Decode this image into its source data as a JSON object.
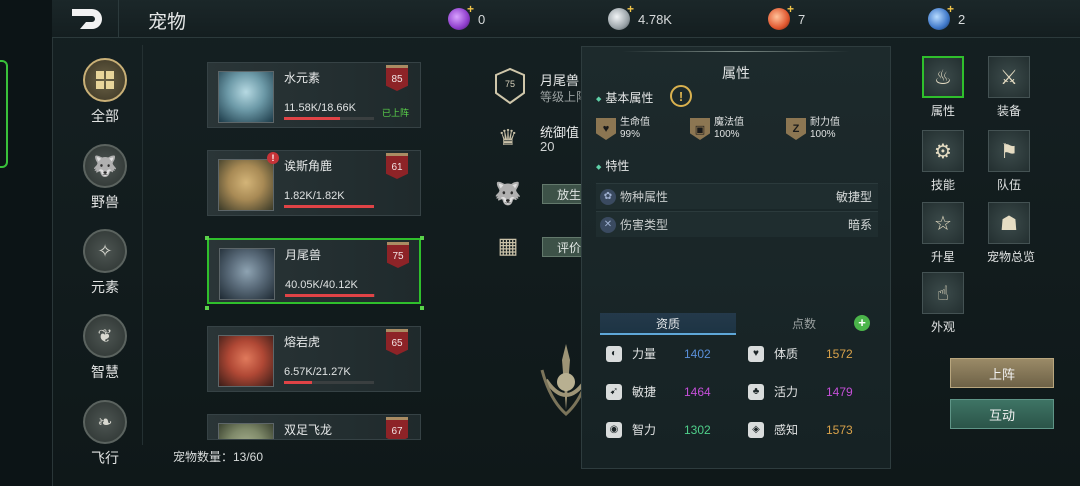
{
  "header": {
    "title": "宠物",
    "back_icon": "back-arrow-icon"
  },
  "resources": [
    {
      "name": "purple-gem",
      "value": "0",
      "color": "#8e3dcc"
    },
    {
      "name": "silver-coin",
      "value": "4.78K",
      "color": "#9aa3a8"
    },
    {
      "name": "orange-gem",
      "value": "7",
      "color": "#e0572f"
    },
    {
      "name": "blue-gem",
      "value": "2",
      "color": "#3f78c9"
    }
  ],
  "categories": [
    {
      "label": "全部",
      "icon": "grid-icon",
      "active": true
    },
    {
      "label": "野兽",
      "icon": "beast-icon"
    },
    {
      "label": "元素",
      "icon": "fairy-icon"
    },
    {
      "label": "智慧",
      "icon": "owl-icon"
    },
    {
      "label": "飞行",
      "icon": "bird-icon"
    }
  ],
  "pets": [
    {
      "name": "水元素",
      "hp": "11.58K/18.66K",
      "hp_ratio": 0.62,
      "level": "85",
      "status": "已上阵",
      "colors": [
        "#6d9aa8",
        "#1c3a48"
      ]
    },
    {
      "name": "诶斯角鹿",
      "hp": "1.82K/1.82K",
      "hp_ratio": 1.0,
      "level": "61",
      "status": "",
      "alert": "!",
      "colors": [
        "#a88a55",
        "#3a3a28"
      ]
    },
    {
      "name": "月尾兽",
      "hp": "40.05K/40.12K",
      "hp_ratio": 0.99,
      "level": "75",
      "status": "",
      "selected": true,
      "colors": [
        "#5a6b7a",
        "#1e2a33"
      ]
    },
    {
      "name": "熔岩虎",
      "hp": "6.57K/21.27K",
      "hp_ratio": 0.31,
      "level": "65",
      "status": "",
      "colors": [
        "#b04835",
        "#3a1d18"
      ]
    },
    {
      "name": "双足飞龙",
      "hp": "",
      "level": "67",
      "status": "",
      "colors": [
        "#7f8a6a",
        "#2f3626"
      ]
    }
  ],
  "pet_count": "宠物数量：13/60",
  "middle": {
    "name": "月尾兽",
    "sub": "等级上阵",
    "level_badge": "75",
    "stat_label": "统御值",
    "stat_value": "20",
    "release_label": "放生",
    "rate_label": "评价"
  },
  "attr_panel": {
    "title": "属性",
    "basic_title": "基本属性",
    "warn_icon": "!",
    "basic": [
      {
        "name": "生命值",
        "value": "99%",
        "icon": "heart-shield-icon"
      },
      {
        "name": "魔法值",
        "value": "100%",
        "icon": "book-shield-icon"
      },
      {
        "name": "耐力值",
        "value": "100%",
        "icon": "stamina-shield-icon"
      }
    ],
    "trait_title": "特性",
    "traits": [
      {
        "label": "物种属性",
        "value": "敏捷型",
        "icon": "paw-icon"
      },
      {
        "label": "伤害类型",
        "value": "暗系",
        "icon": "cross-icon"
      }
    ],
    "tabs": [
      "资质",
      "点数"
    ],
    "plus": "+",
    "aptitudes": [
      {
        "name": "力量",
        "value": "1402",
        "color": "#5a8fd8",
        "icon": "strength-icon"
      },
      {
        "name": "体质",
        "value": "1572",
        "color": "#d9a24a",
        "icon": "heart-icon"
      },
      {
        "name": "敏捷",
        "value": "1464",
        "color": "#c44fd8",
        "icon": "agility-icon"
      },
      {
        "name": "活力",
        "value": "1479",
        "color": "#c44fd8",
        "icon": "vitality-icon"
      },
      {
        "name": "智力",
        "value": "1302",
        "color": "#4fcf8a",
        "icon": "intellect-icon"
      },
      {
        "name": "感知",
        "value": "1573",
        "color": "#d9a24a",
        "icon": "perception-icon"
      }
    ]
  },
  "right_menu": [
    {
      "label": "属性",
      "icon": "flame-icon",
      "active": true
    },
    {
      "label": "装备",
      "icon": "swords-icon"
    },
    {
      "label": "技能",
      "icon": "skill-icon"
    },
    {
      "label": "队伍",
      "icon": "flag-icon"
    },
    {
      "label": "升星",
      "icon": "star-icon"
    },
    {
      "label": "宠物总览",
      "icon": "bag-icon"
    },
    {
      "label": "外观",
      "icon": "hand-icon"
    }
  ],
  "actions": {
    "deploy": "上阵",
    "interact": "互动"
  }
}
